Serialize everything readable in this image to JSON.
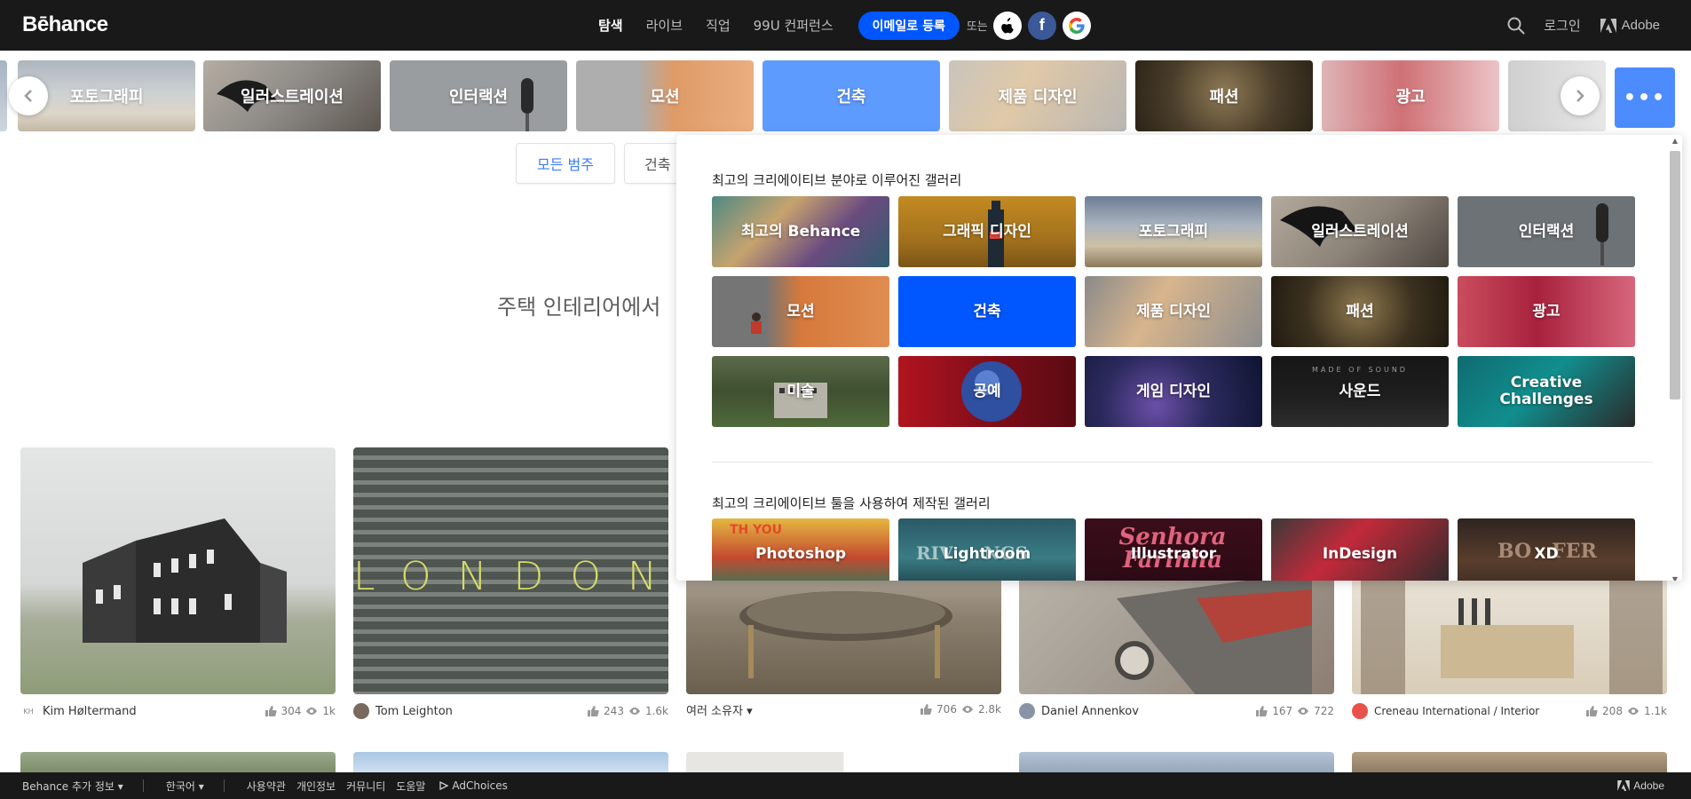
{
  "header": {
    "logo": "Bēhance",
    "nav": [
      "탐색",
      "라이브",
      "직업",
      "99U 컨퍼런스"
    ],
    "signup": "이메일로 등록",
    "or": "또는",
    "login": "로그인",
    "adobe": "Adobe"
  },
  "category_strip": [
    "포토그래피",
    "일러스트레이션",
    "인터랙션",
    "모션",
    "건축",
    "제품 디자인",
    "패션",
    "광고"
  ],
  "more_label": "•••",
  "filters": {
    "all": "모든 범주",
    "arch": "건축"
  },
  "headline": "주택 인테리어에서",
  "grid": [
    {
      "owner": "Kim Høltermand",
      "avatar": "KH",
      "likes": "304",
      "views": "1k"
    },
    {
      "owner": "Tom Leighton",
      "avatar": "",
      "likes": "243",
      "views": "1.6k"
    },
    {
      "owner": "여러 소유자 ▾",
      "avatar": "",
      "likes": "706",
      "views": "2.8k"
    },
    {
      "owner": "Daniel Annenkov",
      "avatar": "",
      "likes": "167",
      "views": "722"
    },
    {
      "owner": "Creneau International / Interior",
      "avatar": "",
      "likes": "208",
      "views": "1.1k"
    }
  ],
  "london_text": "LONDON",
  "panel": {
    "section1_title": "최고의 크리에이티브 분야로 이루어진 갤러리",
    "section2_title": "최고의 크리에이티브 툴을 사용하여 제작된 갤러리",
    "fields": [
      "최고의 Behance",
      "그래픽 디자인",
      "포토그래피",
      "일러스트레이션",
      "인터랙션",
      "모션",
      "건축",
      "제품 디자인",
      "패션",
      "광고",
      "미술",
      "공예",
      "게임 디자인",
      "사운드",
      "Creative Challenges"
    ],
    "tools": [
      "Photoshop",
      "Lightroom",
      "Illustrator",
      "InDesign",
      "XD"
    ],
    "tile_decor": {
      "sound": "MADE OF SOUND",
      "lightroom": "RIV     NGS",
      "illustrator": "Senhora Farinha",
      "xd": "BO   FER",
      "photoshop": "TH   YOU"
    }
  },
  "footer": {
    "more": "Behance 추가 정보 ▾",
    "lang": "한국어 ▾",
    "terms": "사용약관",
    "privacy": "개인정보",
    "community": "커뮤니티",
    "help": "도움말",
    "adchoices": "AdChoices",
    "adobe": "Adobe"
  },
  "colors": {
    "brand_blue": "#0057ff",
    "selected_tile": "#0057ff",
    "header_bg": "#191919"
  }
}
